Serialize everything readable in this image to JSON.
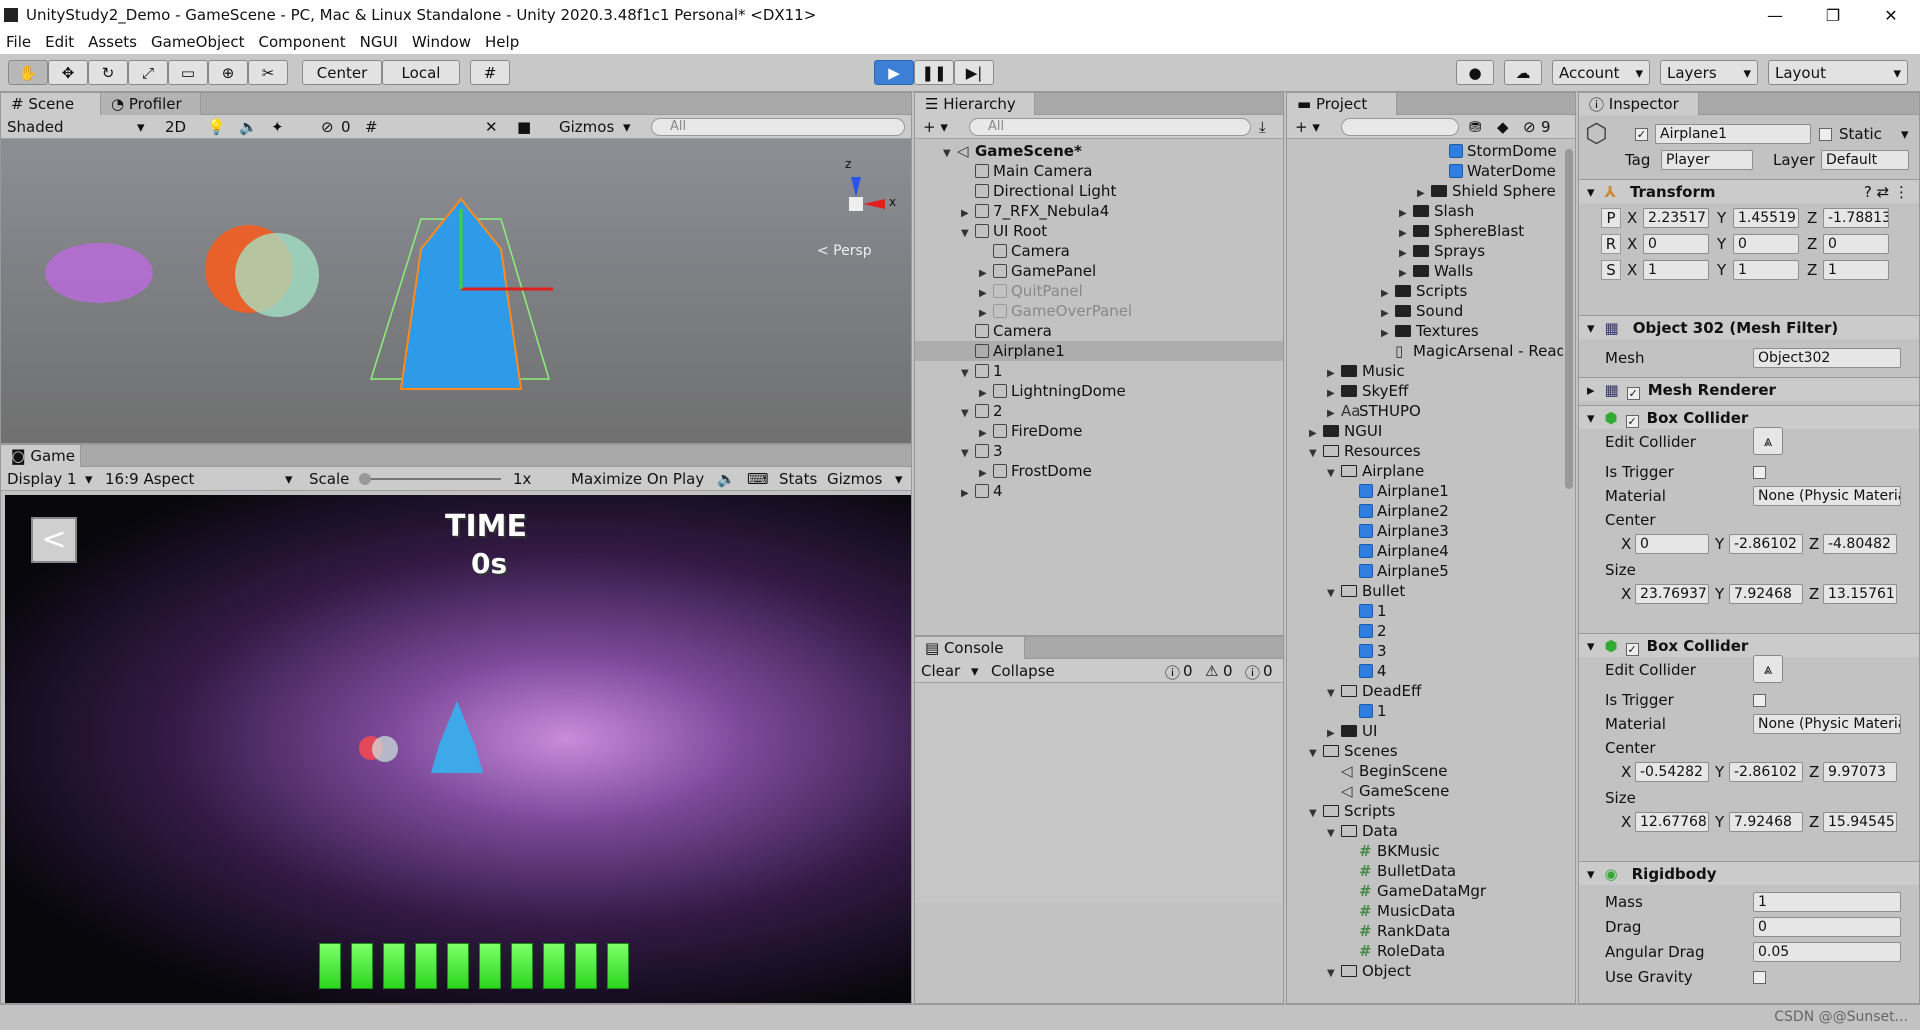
{
  "window": {
    "title": "UnityStudy2_Demo - GameScene - PC, Mac & Linux Standalone - Unity 2020.3.48f1c1 Personal* <DX11>",
    "min": "—",
    "max": "❐",
    "close": "✕"
  },
  "menu": [
    "File",
    "Edit",
    "Assets",
    "GameObject",
    "Component",
    "NGUI",
    "Window",
    "Help"
  ],
  "toolbar": {
    "center": "Center",
    "local": "Local",
    "account": "Account",
    "layers": "Layers",
    "layout": "Layout"
  },
  "scene": {
    "tab": "Scene",
    "tab2": "Profiler",
    "shading": "Shaded",
    "mode2d": "2D",
    "fx_count": "0",
    "gizmos": "Gizmos",
    "search": "All",
    "persp": "< Persp",
    "axis_x": "x",
    "axis_z": "z"
  },
  "game": {
    "tab": "Game",
    "display": "Display 1",
    "aspect": "16:9 Aspect",
    "scale_label": "Scale",
    "scale_value": "1x",
    "maximize": "Maximize On Play",
    "stats": "Stats",
    "gizmos": "Gizmos",
    "hud_time": "TIME",
    "hud_value": "0s",
    "health_bars": 10
  },
  "hierarchy": {
    "tab": "Hierarchy",
    "search": "All",
    "rows": [
      {
        "label": "GameScene*",
        "depth": 0,
        "icon": "scene",
        "arrow": "down",
        "bold": true
      },
      {
        "label": "Main Camera",
        "depth": 1,
        "icon": "cube"
      },
      {
        "label": "Directional Light",
        "depth": 1,
        "icon": "cube"
      },
      {
        "label": "7_RFX_Nebula4",
        "depth": 1,
        "icon": "cube",
        "arrow": "right"
      },
      {
        "label": "UI Root",
        "depth": 1,
        "icon": "cube",
        "arrow": "down"
      },
      {
        "label": "Camera",
        "depth": 2,
        "icon": "cube"
      },
      {
        "label": "GamePanel",
        "depth": 2,
        "icon": "cube",
        "arrow": "right"
      },
      {
        "label": "QuitPanel",
        "depth": 2,
        "icon": "cube",
        "arrow": "right",
        "faded": true
      },
      {
        "label": "GameOverPanel",
        "depth": 2,
        "icon": "cube",
        "arrow": "right",
        "faded": true
      },
      {
        "label": "Camera",
        "depth": 1,
        "icon": "cube"
      },
      {
        "label": "Airplane1",
        "depth": 1,
        "icon": "cube",
        "selected": true
      },
      {
        "label": "1",
        "depth": 1,
        "icon": "cube",
        "arrow": "down"
      },
      {
        "label": "LightningDome",
        "depth": 2,
        "icon": "cube",
        "arrow": "right"
      },
      {
        "label": "2",
        "depth": 1,
        "icon": "cube",
        "arrow": "down"
      },
      {
        "label": "FireDome",
        "depth": 2,
        "icon": "cube",
        "arrow": "right"
      },
      {
        "label": "3",
        "depth": 1,
        "icon": "cube",
        "arrow": "down"
      },
      {
        "label": "FrostDome",
        "depth": 2,
        "icon": "cube",
        "arrow": "right"
      },
      {
        "label": "4",
        "depth": 1,
        "icon": "cube",
        "arrow": "right"
      }
    ]
  },
  "console": {
    "tab": "Console",
    "clear": "Clear",
    "collapse": "Collapse",
    "info": "0",
    "warn": "0",
    "err": "0"
  },
  "project": {
    "tab": "Project",
    "badge": "9",
    "rows": [
      {
        "label": "StormDome",
        "depth": 8,
        "icon": "prefab"
      },
      {
        "label": "WaterDome",
        "depth": 8,
        "icon": "prefab"
      },
      {
        "label": "Shield Sphere",
        "depth": 7,
        "icon": "folder",
        "arrow": "right"
      },
      {
        "label": "Slash",
        "depth": 6,
        "icon": "folder",
        "arrow": "right"
      },
      {
        "label": "SphereBlast",
        "depth": 6,
        "icon": "folder",
        "arrow": "right"
      },
      {
        "label": "Sprays",
        "depth": 6,
        "icon": "folder",
        "arrow": "right"
      },
      {
        "label": "Walls",
        "depth": 6,
        "icon": "folder",
        "arrow": "right"
      },
      {
        "label": "Scripts",
        "depth": 5,
        "icon": "folder",
        "arrow": "right"
      },
      {
        "label": "Sound",
        "depth": 5,
        "icon": "folder",
        "arrow": "right"
      },
      {
        "label": "Textures",
        "depth": 5,
        "icon": "folder",
        "arrow": "right"
      },
      {
        "label": "MagicArsenal - ReadMe",
        "depth": 5,
        "icon": "doc"
      },
      {
        "label": "Music",
        "depth": 2,
        "icon": "folder",
        "arrow": "right"
      },
      {
        "label": "SkyEff",
        "depth": 2,
        "icon": "folder",
        "arrow": "right"
      },
      {
        "label": "STHUPO",
        "depth": 2,
        "icon": "font",
        "arrow": "right"
      },
      {
        "label": "NGUI",
        "depth": 1,
        "icon": "folder",
        "arrow": "right"
      },
      {
        "label": "Resources",
        "depth": 1,
        "icon": "folderopen",
        "arrow": "down"
      },
      {
        "label": "Airplane",
        "depth": 2,
        "icon": "folderopen",
        "arrow": "down"
      },
      {
        "label": "Airplane1",
        "depth": 3,
        "icon": "prefab"
      },
      {
        "label": "Airplane2",
        "depth": 3,
        "icon": "prefab"
      },
      {
        "label": "Airplane3",
        "depth": 3,
        "icon": "prefab"
      },
      {
        "label": "Airplane4",
        "depth": 3,
        "icon": "prefab"
      },
      {
        "label": "Airplane5",
        "depth": 3,
        "icon": "prefab"
      },
      {
        "label": "Bullet",
        "depth": 2,
        "icon": "folderopen",
        "arrow": "down"
      },
      {
        "label": "1",
        "depth": 3,
        "icon": "prefab"
      },
      {
        "label": "2",
        "depth": 3,
        "icon": "prefab"
      },
      {
        "label": "3",
        "depth": 3,
        "icon": "prefab"
      },
      {
        "label": "4",
        "depth": 3,
        "icon": "prefab"
      },
      {
        "label": "DeadEff",
        "depth": 2,
        "icon": "folderopen",
        "arrow": "down"
      },
      {
        "label": "1",
        "depth": 3,
        "icon": "prefab"
      },
      {
        "label": "UI",
        "depth": 2,
        "icon": "folder",
        "arrow": "right"
      },
      {
        "label": "Scenes",
        "depth": 1,
        "icon": "folderopen",
        "arrow": "down"
      },
      {
        "label": "BeginScene",
        "depth": 2,
        "icon": "scene"
      },
      {
        "label": "GameScene",
        "depth": 2,
        "icon": "scene"
      },
      {
        "label": "Scripts",
        "depth": 1,
        "icon": "folderopen",
        "arrow": "down"
      },
      {
        "label": "Data",
        "depth": 2,
        "icon": "folderopen",
        "arrow": "down"
      },
      {
        "label": "BKMusic",
        "depth": 3,
        "icon": "script"
      },
      {
        "label": "BulletData",
        "depth": 3,
        "icon": "script"
      },
      {
        "label": "GameDataMgr",
        "depth": 3,
        "icon": "script"
      },
      {
        "label": "MusicData",
        "depth": 3,
        "icon": "script"
      },
      {
        "label": "RankData",
        "depth": 3,
        "icon": "script"
      },
      {
        "label": "RoleData",
        "depth": 3,
        "icon": "script"
      },
      {
        "label": "Object",
        "depth": 2,
        "icon": "folderopen",
        "arrow": "down"
      }
    ]
  },
  "inspector": {
    "tab": "Inspector",
    "name": "Airplane1",
    "static": "Static",
    "tag_label": "Tag",
    "tag": "Player",
    "layer_label": "Layer",
    "layer": "Default",
    "transform": {
      "title": "Transform",
      "p": [
        "2.23517",
        "1.45519",
        "-1.78813"
      ],
      "r": [
        "0",
        "0",
        "0"
      ],
      "s": [
        "1",
        "1",
        "1"
      ]
    },
    "meshfilter": {
      "title": "Object 302 (Mesh Filter)",
      "mesh_label": "Mesh",
      "mesh": "Object302"
    },
    "meshrenderer": {
      "title": "Mesh Renderer"
    },
    "box1": {
      "title": "Box Collider",
      "edit": "Edit Collider",
      "trigger": "Is Trigger",
      "material_label": "Material",
      "material": "None (Physic Material)",
      "center_label": "Center",
      "center": [
        "0",
        "-2.86102",
        "-4.80482"
      ],
      "size_label": "Size",
      "size": [
        "23.76937",
        "7.92468",
        "13.15761"
      ]
    },
    "box2": {
      "title": "Box Collider",
      "edit": "Edit Collider",
      "trigger": "Is Trigger",
      "material_label": "Material",
      "material": "None (Physic Material)",
      "center_label": "Center",
      "center": [
        "-0.54282",
        "-2.86102",
        "9.97073"
      ],
      "size_label": "Size",
      "size": [
        "12.67768",
        "7.92468",
        "15.94545"
      ]
    },
    "rigidbody": {
      "title": "Rigidbody",
      "mass_label": "Mass",
      "mass": "1",
      "drag_label": "Drag",
      "drag": "0",
      "adrag_label": "Angular Drag",
      "adrag": "0.05",
      "gravity_label": "Use Gravity"
    }
  },
  "watermark": "CSDN @@Sunset..."
}
